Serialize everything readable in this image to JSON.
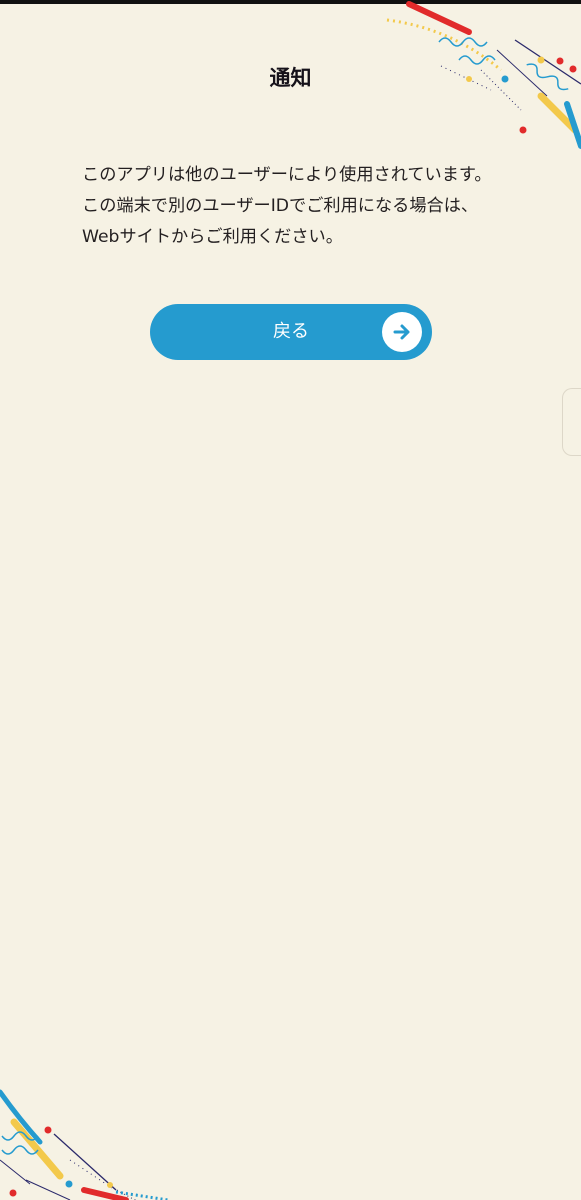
{
  "header": {
    "title": "通知"
  },
  "message": {
    "text": "このアプリは他のユーザーにより使用されています。この端末で別のユーザーIDでご利用になる場合は、Webサイトからご利用ください。"
  },
  "back_button": {
    "label": "戻る",
    "icon": "arrow-right-icon"
  },
  "colors": {
    "background": "#f6f2e4",
    "accent_blue": "#259bcf",
    "red": "#e12b2b",
    "yellow": "#f3c94b",
    "navy": "#2b2a6b"
  }
}
